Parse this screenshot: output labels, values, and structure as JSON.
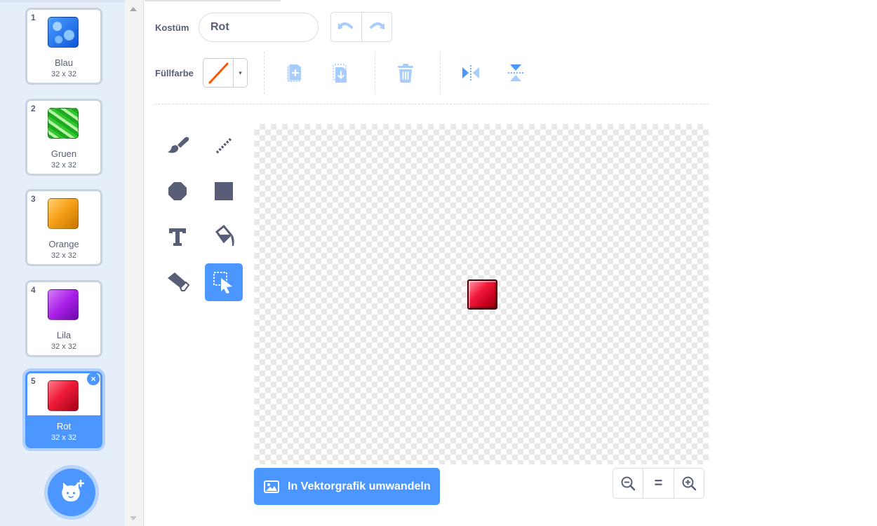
{
  "costume_list": {
    "items": [
      {
        "number": "1",
        "name": "Blau",
        "size": "32 x 32",
        "swatch": "blau"
      },
      {
        "number": "2",
        "name": "Gruen",
        "size": "32 x 32",
        "swatch": "gruen"
      },
      {
        "number": "3",
        "name": "Orange",
        "size": "32 x 32",
        "swatch": "orange"
      },
      {
        "number": "4",
        "name": "Lila",
        "size": "32 x 32",
        "swatch": "lila"
      },
      {
        "number": "5",
        "name": "Rot",
        "size": "32 x 32",
        "swatch": "rot",
        "selected": true
      }
    ],
    "delete_icon": "×",
    "add_button_icon": "cat-plus-icon"
  },
  "editor": {
    "costume_label": "Kostüm",
    "costume_name": "Rot",
    "fill_label": "Füllfarbe",
    "fill_color": "none",
    "caret": "▾",
    "convert_button": "In Vektorgrafik umwandeln",
    "zoom": {
      "out": "zoom-out-icon",
      "reset": "=",
      "in": "zoom-in-icon"
    }
  },
  "colors": {
    "accent": "#4c97ff",
    "text": "#575e75",
    "panel": "#e6eef9",
    "icon_dark": "#575e75",
    "no_fill_slash": "#ff5500"
  }
}
